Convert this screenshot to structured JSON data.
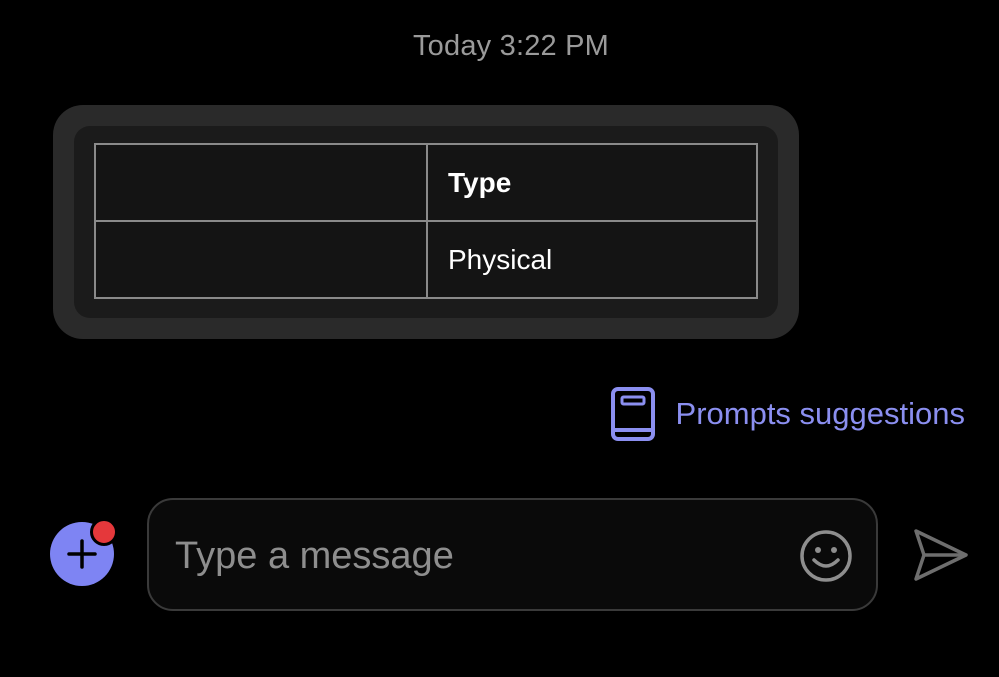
{
  "timestamp": "Today 3:22 PM",
  "message": {
    "table": {
      "rows": [
        [
          "",
          "Type"
        ],
        [
          "",
          "Physical"
        ]
      ]
    }
  },
  "prompts": {
    "icon": "book-icon",
    "label": "Prompts suggestions"
  },
  "composer": {
    "add_icon": "plus-icon",
    "placeholder": "Type a message",
    "emoji_icon": "smiley-icon",
    "send_icon": "send-icon"
  },
  "colors": {
    "background": "#000000",
    "accent": "#7e84f3",
    "link": "#8b8ff0",
    "notification": "#e5383b",
    "bubble": "#2a2a2a"
  }
}
